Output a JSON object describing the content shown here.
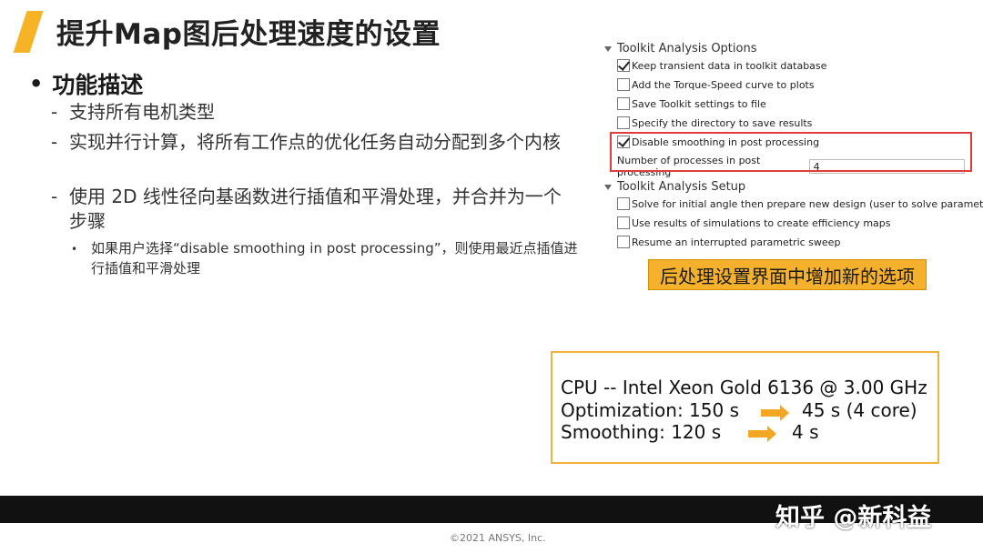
{
  "slide": {
    "title": "提升Map图后处理速度的设置",
    "bullet": "功能描述",
    "sub_items": [
      "支持所有电机类型",
      "实现并行计算，将所有工作点的优化任务自动分配到多个内核",
      "使用 2D 线性径向基函数进行插值和平滑处理，并合并为一个步骤"
    ],
    "sub_sub_item": "如果用户选择“disable smoothing in post processing”，则使用最近点插值进行插值和平滑处理"
  },
  "settings_panel": {
    "section1_title": "Toolkit Analysis Options",
    "options": [
      {
        "label": "Keep transient data in toolkit database",
        "checked": true
      },
      {
        "label": "Add the Torque-Speed curve to plots",
        "checked": false
      },
      {
        "label": "Save Toolkit settings to file",
        "checked": false
      },
      {
        "label": "Specify the directory to save results",
        "checked": false
      },
      {
        "label": "Disable smoothing in post processing",
        "checked": true
      }
    ],
    "num_processes_label": "Number of processes in post processing",
    "num_processes_value": "4",
    "section2_title": "Toolkit Analysis Setup",
    "setup_options": [
      {
        "label": "Solve for initial angle then prepare new design (user to solve parametric table)",
        "checked": false
      },
      {
        "label": "Use results of simulations to create efficiency maps",
        "checked": false
      },
      {
        "label": "Resume an interrupted parametric sweep",
        "checked": false
      }
    ]
  },
  "callout": "后处理设置界面中增加新的选项",
  "performance": {
    "cpu_line": "CPU -- Intel Xeon Gold 6136 @ 3.00 GHz",
    "opt_before": "Optimization: 150 s",
    "opt_after": "45 s (4 core)",
    "smooth_before": "Smoothing: 120 s",
    "smooth_after": "4 s"
  },
  "footer": {
    "watermark": "知乎 @新科益",
    "copyright": "©2021 ANSYS, Inc."
  },
  "colors": {
    "accent": "#f5b325",
    "highlight_border": "#e23b3b",
    "callout_bg": "#f6b12c"
  }
}
